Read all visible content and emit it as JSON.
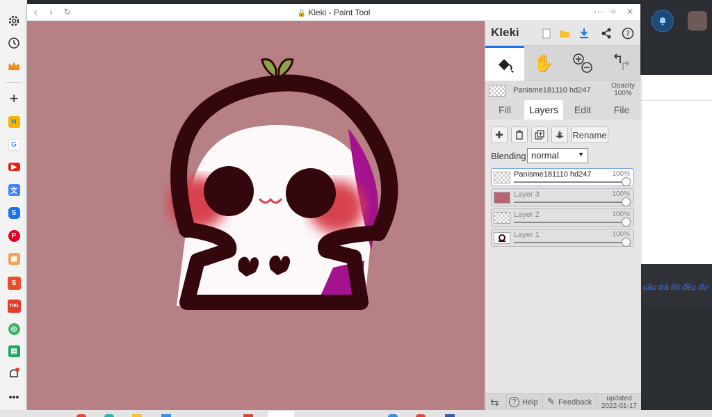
{
  "window": {
    "title": "Kleki - Paint Tool"
  },
  "app": {
    "logo": "Kleki",
    "brush_name": "Panisme181110 hd247",
    "opacity_label": "Opacity",
    "opacity_value": "100%"
  },
  "tabs": [
    "Fill",
    "Layers",
    "Edit",
    "File"
  ],
  "layer_panel": {
    "rename_label": "Rename",
    "blending_label": "Blending",
    "blending_value": "normal",
    "layers": [
      {
        "name": "Panisme181110 hd247",
        "opacity": "100%",
        "selected": true
      },
      {
        "name": "Layer 3",
        "opacity": "100%"
      },
      {
        "name": "Layer 2",
        "opacity": "100%"
      },
      {
        "name": "Layer 1",
        "opacity": "100%"
      }
    ]
  },
  "bottom": {
    "help_label": "Help",
    "feedback_label": "Feedback",
    "updated_label": "updated",
    "updated_date": "2022-01-17"
  },
  "background_page": {
    "text": "câu trả lời đều đư"
  },
  "colors": {
    "canvas_bg": "#b68085",
    "outline": "#34070d",
    "blush": "#d8424f",
    "magenta": "#a4138d",
    "sprout": "#8aa64a",
    "accent": "#1a73e8"
  }
}
